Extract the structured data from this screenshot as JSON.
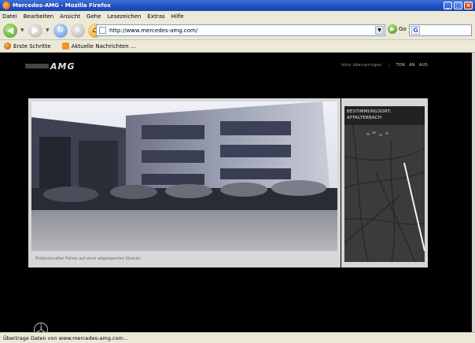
{
  "window": {
    "title": "Mercedes-AMG - Mozilla Firefox",
    "buttons": {
      "minimize": "_",
      "maximize": "□",
      "close": "×"
    }
  },
  "menu": [
    "Datei",
    "Bearbeiten",
    "Ansicht",
    "Gehe",
    "Lesezeichen",
    "Extras",
    "Hilfe"
  ],
  "toolbar": {
    "url": "http://www.mercedes-amg.com/",
    "go_label": "Go"
  },
  "bookmarks": [
    {
      "label": "Erste Schritte",
      "icon": "firefox-icon"
    },
    {
      "label": "Aktuelle Nachrichten ...",
      "icon": "rss-icon"
    }
  ],
  "page": {
    "logo_text": "AMG",
    "topnav": {
      "privacy_link": "Intro überspringen",
      "sound_label": "TON",
      "sound_on": "AN",
      "sound_off": "AUS"
    },
    "video_caption": "Professioneller Fahrer auf einer abgesperrten Strecke",
    "map_header_line1": "BESTIMMUNGSORT:",
    "map_header_line2": "AFFALTERBACH"
  },
  "status": {
    "text": "Übertrage Daten von www.mercedes-amg.com..."
  },
  "colors": {
    "titlebar": "#1e4fbf",
    "chrome": "#ece9d8",
    "page_background": "#000000",
    "panel_frame": "#d7d7d7"
  }
}
